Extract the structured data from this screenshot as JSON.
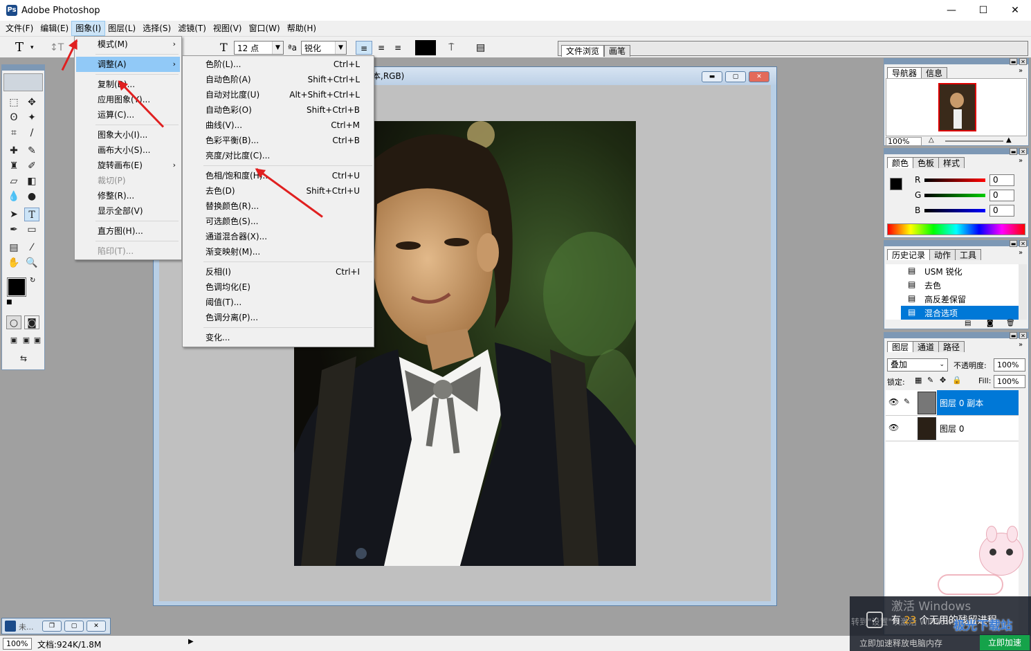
{
  "window": {
    "title": "Adobe Photoshop",
    "min": "—",
    "max": "☐",
    "close": "✕"
  },
  "menubar": [
    "文件(F)",
    "编辑(E)",
    "图象(I)",
    "图层(L)",
    "选择(S)",
    "滤镜(T)",
    "视图(V)",
    "窗口(W)",
    "帮助(H)"
  ],
  "optbar": {
    "tool_glyph": "T",
    "font_size": "12 点",
    "aa_label": "ªa",
    "antialias": "锐化",
    "panel_tabs": [
      "文件浏览",
      "画笔"
    ]
  },
  "image_menu": {
    "items": [
      {
        "label": "模式(M)",
        "submenu": true
      },
      {
        "label": "调整(A)",
        "submenu": true,
        "highlighted": true
      },
      {
        "label": "复制(D)..."
      },
      {
        "label": "应用图象(Y)..."
      },
      {
        "label": "运算(C)..."
      },
      {
        "label": "图象大小(I)..."
      },
      {
        "label": "画布大小(S)..."
      },
      {
        "label": "旋转画布(E)",
        "submenu": true
      },
      {
        "label": "裁切(P)",
        "disabled": true
      },
      {
        "label": "修整(R)..."
      },
      {
        "label": "显示全部(V)"
      },
      {
        "label": "直方图(H)..."
      },
      {
        "label": "陷印(T)...",
        "disabled": true
      }
    ]
  },
  "adjust_menu": {
    "items": [
      {
        "label": "色阶(L)...",
        "shortcut": "Ctrl+L"
      },
      {
        "label": "自动色阶(A)",
        "shortcut": "Shift+Ctrl+L"
      },
      {
        "label": "自动对比度(U)",
        "shortcut": "Alt+Shift+Ctrl+L"
      },
      {
        "label": "自动色彩(O)",
        "shortcut": "Shift+Ctrl+B"
      },
      {
        "label": "曲线(V)...",
        "shortcut": "Ctrl+M"
      },
      {
        "label": "色彩平衡(B)...",
        "shortcut": "Ctrl+B"
      },
      {
        "label": "亮度/对比度(C)...",
        "shortcut": ""
      },
      {
        "label": "色相/饱和度(H)...",
        "shortcut": "Ctrl+U"
      },
      {
        "label": "去色(D)",
        "shortcut": "Shift+Ctrl+U"
      },
      {
        "label": "替换颜色(R)...",
        "shortcut": ""
      },
      {
        "label": "可选颜色(S)...",
        "shortcut": ""
      },
      {
        "label": "通道混合器(X)...",
        "shortcut": ""
      },
      {
        "label": "渐变映射(M)...",
        "shortcut": ""
      },
      {
        "label": "反相(I)",
        "shortcut": "Ctrl+I"
      },
      {
        "label": "色调均化(E)",
        "shortcut": ""
      },
      {
        "label": "阈值(T)...",
        "shortcut": ""
      },
      {
        "label": "色调分离(P)...",
        "shortcut": ""
      },
      {
        "label": "变化...",
        "shortcut": ""
      }
    ]
  },
  "document": {
    "title_fragment": "本,RGB)"
  },
  "navigator": {
    "tabs": [
      "导航器",
      "信息"
    ],
    "zoom": "100%"
  },
  "color_panel": {
    "tabs": [
      "颜色",
      "色板",
      "样式"
    ],
    "channels": [
      {
        "label": "R",
        "value": "0",
        "color": "#e00000"
      },
      {
        "label": "G",
        "value": "0",
        "color": "#00a000"
      },
      {
        "label": "B",
        "value": "0",
        "color": "#0000e0"
      }
    ]
  },
  "history_panel": {
    "tabs": [
      "历史记录",
      "动作",
      "工具"
    ],
    "items": [
      "USM 锐化",
      "去色",
      "高反差保留",
      "混合选项"
    ]
  },
  "layers_panel": {
    "tabs": [
      "图层",
      "通道",
      "路径"
    ],
    "blend_mode": "叠加",
    "opacity_label": "不透明度:",
    "opacity": "100%",
    "lock_label": "锁定:",
    "fill_label": "Fill:",
    "fill": "100%",
    "layers": [
      {
        "name": "图层 0 副本",
        "selected": true
      },
      {
        "name": "图层 0",
        "selected": false
      }
    ]
  },
  "minimized_doc": {
    "label": "未..."
  },
  "status": {
    "zoom": "100%",
    "doc_info": "文档:924K/1.8M"
  },
  "overlay": {
    "watermark_text": "激活 Windows",
    "watermark_sub": "转到\"设置\"以激活 Windows",
    "notice_prefix": "有",
    "notice_count": "23",
    "notice_suffix": "个无用的残留进程",
    "notice_sub": "立即加速释放电脑内存",
    "notice_button": "立即加速",
    "brand": "极光下载站"
  },
  "colors": {
    "accent": "#0078d7",
    "arrow": "#e02020",
    "menu_hl": "#91c9f7"
  }
}
